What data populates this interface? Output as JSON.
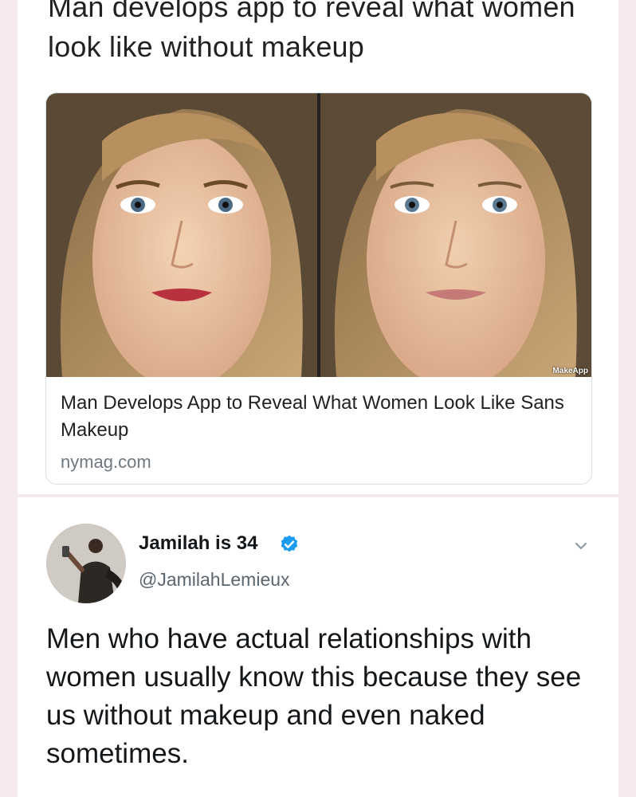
{
  "headline": {
    "text": "Man develops app to reveal what women look like without makeup"
  },
  "link_card": {
    "image_watermark": "MakeApp",
    "title": "Man Develops App to Reveal What Women Look Like Sans Makeup",
    "domain": "nymag.com"
  },
  "tweet": {
    "display_name": "Jamilah is 34",
    "handle": "@JamilahLemieux",
    "text": "Men who have actual relationships with women usually know this because they see us without makeup and even naked sometimes.",
    "verified_icon": "verified-badge-icon",
    "menu_icon": "chevron-down-icon"
  },
  "colors": {
    "background": "#f6e9ec",
    "card": "#ffffff",
    "verified_blue": "#1d9bf0",
    "handle_gray": "#5b6670"
  }
}
